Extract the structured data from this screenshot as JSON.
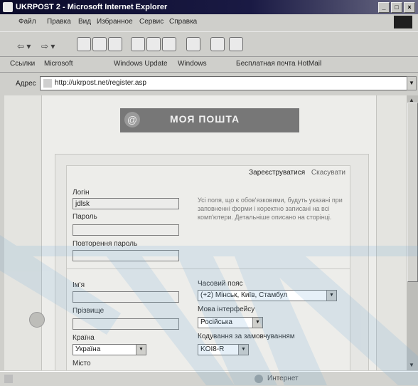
{
  "window": {
    "title": "UKRPOST 2 - Microsoft Internet Explorer",
    "min": "_",
    "max": "□",
    "close": "×"
  },
  "menu": [
    "Файл",
    "Правка",
    "Вид",
    "Избранное",
    "Сервис",
    "Справка"
  ],
  "links": {
    "label": "Ссылки",
    "items": [
      "Microsoft",
      "Windows Update",
      "Windows",
      "Бесплатная почта HotMail"
    ]
  },
  "address": {
    "label": "Адрес",
    "url": "http://ukrpost.net/register.asp"
  },
  "page": {
    "logo_text": "МОЯ ПОШТА",
    "register_link": "Зареєструватися",
    "cancel_link": "Скасувати",
    "login_label": "Логін",
    "login_value": "jdlsk",
    "password_label": "Пароль",
    "password_repeat_label": "Повторення пароль",
    "info_text": "Усі поля, що є обов'язковими, будуть указані при заповненні форми і коректно записані на всі комп'ютери. Детальніше описано на сторінці.",
    "name_label": "Ім'я",
    "surname_label": "Прізвище",
    "country_label": "Країна",
    "country_value": "Україна",
    "city_label": "Місто",
    "timezone_label": "Часовий пояс",
    "timezone_value": "(+2) Мінськ, Київ, Стамбул",
    "language_label": "Мова інтерфейсу",
    "language_value": "Російська",
    "encoding_label": "Кодування за замовчуванням",
    "encoding_value": "KOI8-R"
  },
  "status": {
    "zone": "Интернет"
  },
  "icons": [
    "ie-logo-icon",
    "back-icon",
    "forward-icon",
    "stop-icon",
    "refresh-icon",
    "home-icon",
    "search-icon",
    "favorites-icon",
    "history-icon",
    "mail-icon",
    "print-icon",
    "edit-icon",
    "page-icon",
    "globe-icon"
  ]
}
